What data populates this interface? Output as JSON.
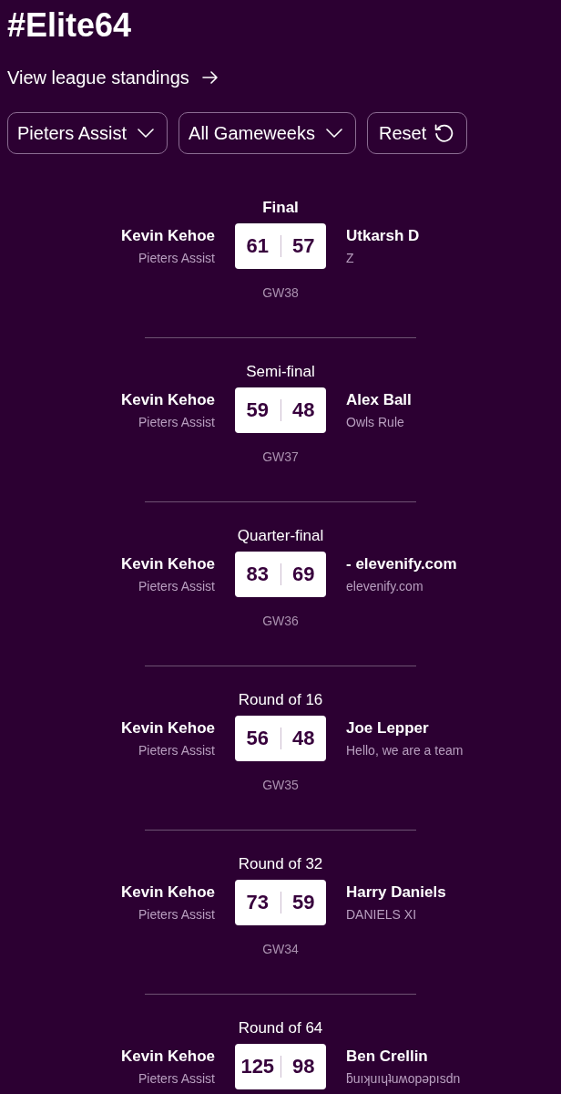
{
  "page": {
    "title": "#Elite64",
    "standings_link": "View league standings"
  },
  "filters": [
    {
      "kind": "dropdown",
      "label": "Pieters Assist"
    },
    {
      "kind": "dropdown",
      "label": "All Gameweeks"
    },
    {
      "kind": "reset",
      "label": "Reset"
    }
  ],
  "matches": [
    {
      "round": "Final",
      "highlighted": true,
      "home": {
        "name": "Kevin Kehoe",
        "team": "Pieters Assist",
        "score": "61"
      },
      "away": {
        "name": "Utkarsh D",
        "team": "Z",
        "score": "57"
      },
      "gameweek": "GW38"
    },
    {
      "round": "Semi-final",
      "highlighted": false,
      "home": {
        "name": "Kevin Kehoe",
        "team": "Pieters Assist",
        "score": "59"
      },
      "away": {
        "name": "Alex Ball",
        "team": "Owls Rule",
        "score": "48"
      },
      "gameweek": "GW37"
    },
    {
      "round": "Quarter-final",
      "highlighted": false,
      "home": {
        "name": "Kevin Kehoe",
        "team": "Pieters Assist",
        "score": "83"
      },
      "away": {
        "name": "- elevenify.com",
        "team": "elevenify.com",
        "score": "69"
      },
      "gameweek": "GW36"
    },
    {
      "round": "Round of 16",
      "highlighted": false,
      "home": {
        "name": "Kevin Kehoe",
        "team": "Pieters Assist",
        "score": "56"
      },
      "away": {
        "name": "Joe Lepper",
        "team": "Hello, we are a team",
        "score": "48"
      },
      "gameweek": "GW35"
    },
    {
      "round": "Round of 32",
      "highlighted": false,
      "home": {
        "name": "Kevin Kehoe",
        "team": "Pieters Assist",
        "score": "73"
      },
      "away": {
        "name": "Harry Daniels",
        "team": "DANIELS XI",
        "score": "59"
      },
      "gameweek": "GW34"
    },
    {
      "round": "Round of 64",
      "highlighted": false,
      "home": {
        "name": "Kevin Kehoe",
        "team": "Pieters Assist",
        "score": "125"
      },
      "away": {
        "name": "Ben Crellin",
        "team": "ƃuıʞuıɥʇuʍopǝpısdn",
        "score": "98"
      }
    }
  ]
}
